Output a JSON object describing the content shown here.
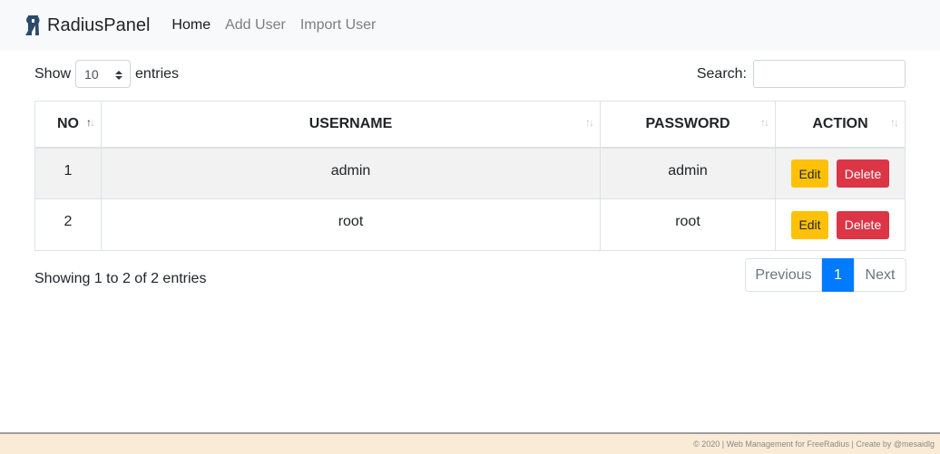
{
  "navbar": {
    "brand": "RadiusPanel",
    "logo_icon": "radiuspanel-logo",
    "links": [
      "Home",
      "Add User",
      "Import User"
    ],
    "active": "Home"
  },
  "controls": {
    "show_label": "Show",
    "page_length": "10",
    "entries_label": "entries",
    "search_label": "Search:",
    "search_value": ""
  },
  "table": {
    "columns": [
      "NO",
      "USERNAME",
      "PASSWORD",
      "ACTION"
    ],
    "sorted_column": "NO",
    "rows": [
      {
        "no": "1",
        "username": "admin",
        "password": "admin"
      },
      {
        "no": "2",
        "username": "root",
        "password": "root"
      }
    ],
    "edit_label": "Edit",
    "delete_label": "Delete"
  },
  "pagination": {
    "info": "Showing 1 to 2 of 2 entries",
    "previous": "Previous",
    "current": "1",
    "next": "Next"
  },
  "footer": {
    "text": "© 2020 | Web Management for FreeRadius | Create by @mesaidlg"
  },
  "colors": {
    "primary": "#007bff",
    "warning": "#ffc107",
    "danger": "#dc3545",
    "footer_bg": "#faebd7"
  }
}
